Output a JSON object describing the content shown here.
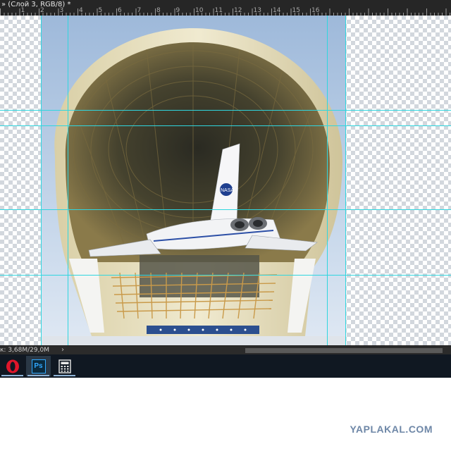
{
  "document": {
    "tab_title": "» (Слой 3, RGB/8) *"
  },
  "ruler": {
    "numbers": [
      "1",
      "2",
      "3",
      "4",
      "5",
      "6",
      "7",
      "8",
      "9",
      "10",
      "11",
      "12",
      "13",
      "14",
      "15",
      "16"
    ]
  },
  "status": {
    "doc_info": "к: 3,68M/29,0M",
    "arrow": "›"
  },
  "taskbar": {
    "items": [
      {
        "name": "opera",
        "icon": "opera-icon",
        "active": false
      },
      {
        "name": "photoshop",
        "icon": "photoshop-icon",
        "label": "Ps",
        "active": true
      },
      {
        "name": "calculator",
        "icon": "calculator-icon",
        "active": false
      }
    ]
  },
  "photo": {
    "tail_logo": "NASA"
  },
  "watermark": "YAPLAKAL.COM",
  "colors": {
    "guide": "#2fd6df",
    "taskbar_bg": "#101822",
    "panel_bg": "#262626",
    "ps_accent": "#31a8ff",
    "opera_red": "#e0162b"
  }
}
